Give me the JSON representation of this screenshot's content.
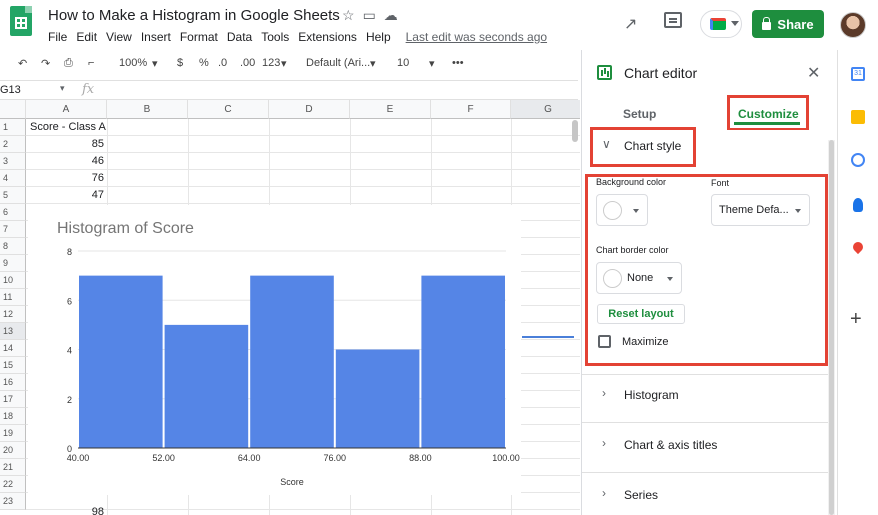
{
  "doc": {
    "title": "How to Make a Histogram in Google Sheets",
    "star_icon": "star-icon",
    "folder_icon": "folder-icon",
    "cloud_icon": "cloud-icon"
  },
  "menu": [
    "File",
    "Edit",
    "View",
    "Insert",
    "Format",
    "Data",
    "Tools",
    "Extensions",
    "Help"
  ],
  "last_edit": "Last edit was seconds ago",
  "header_right": {
    "share_label": "Share",
    "accent": "#1e8e3e"
  },
  "toolbar": {
    "zoom": "100%",
    "currency": "$",
    "percent": "%",
    "dec_less": ".0",
    "dec_more": ".00",
    "more_formats": "123",
    "font": "Default (Ari...",
    "font_size": "10",
    "more": "•••"
  },
  "formula_bar": {
    "cell_ref": "G13",
    "fx": "fx"
  },
  "sheet": {
    "columns": [
      "A",
      "B",
      "C",
      "D",
      "E",
      "F",
      "G"
    ],
    "rows": [
      "1",
      "2",
      "3",
      "4",
      "5",
      "6",
      "7",
      "8",
      "9",
      "10",
      "11",
      "12",
      "13",
      "14",
      "15",
      "16",
      "17",
      "18",
      "19",
      "20",
      "21",
      "22",
      "23"
    ],
    "cells": {
      "a1": "Score - Class A",
      "a2": "85",
      "a3": "46",
      "a4": "76",
      "a5": "47",
      "a_last": "98"
    }
  },
  "chart_data": {
    "type": "bar",
    "title": "Histogram of Score",
    "xlabel": "Score",
    "ylabel": "",
    "x_ticks": [
      "40.00",
      "52.00",
      "64.00",
      "76.00",
      "88.00",
      "100.00"
    ],
    "y_ticks": [
      "0",
      "2",
      "4",
      "6",
      "8"
    ],
    "ylim": [
      0,
      8
    ],
    "bins": [
      {
        "from": 40,
        "to": 52,
        "value": 7
      },
      {
        "from": 52,
        "to": 64,
        "value": 5
      },
      {
        "from": 64,
        "to": 76,
        "value": 7
      },
      {
        "from": 76,
        "to": 88,
        "value": 4
      },
      {
        "from": 88,
        "to": 100,
        "value": 7
      }
    ],
    "bar_color": "#5585e6",
    "grid": true
  },
  "editor": {
    "title": "Chart editor",
    "tabs": {
      "setup": "Setup",
      "customize": "Customize"
    },
    "chart_style": "Chart style",
    "background_color_label": "Background color",
    "font_label": "Font",
    "font_value": "Theme Defa...",
    "border_color_label": "Chart border color",
    "border_value": "None",
    "reset_layout": "Reset layout",
    "maximize": "Maximize",
    "sections": [
      "Histogram",
      "Chart & axis titles",
      "Series"
    ]
  },
  "side_icons": {
    "calendar_day": "31"
  }
}
